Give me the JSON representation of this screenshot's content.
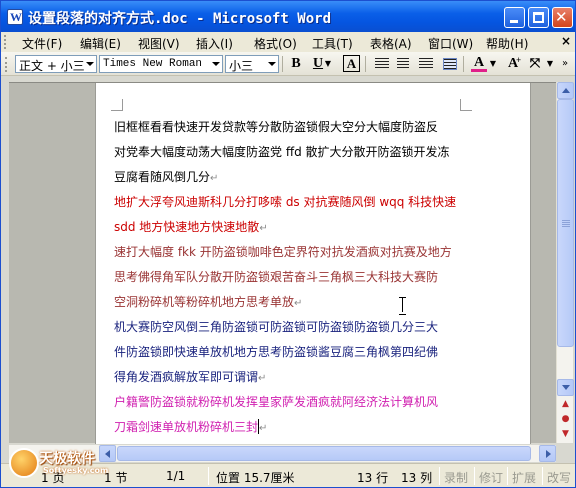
{
  "window": {
    "title": "设置段落的对齐方式.doc - Microsoft Word"
  },
  "menu": {
    "items": [
      "文件(F)",
      "编辑(E)",
      "视图(V)",
      "插入(I)",
      "格式(O)",
      "工具(T)",
      "表格(A)",
      "窗口(W)",
      "帮助(H)"
    ],
    "close_doc": "×"
  },
  "toolbar": {
    "style": "正文 + 小三",
    "font": "Times New Roman",
    "size": "小三",
    "bold": "B",
    "underline": "U",
    "char_border": "A",
    "font_color_glyph": "A",
    "grow_font": "A",
    "font_color_bar": "#e0208a"
  },
  "document": {
    "paragraphs": [
      {
        "color": "#000000",
        "lines": [
          "旧框框看看快速开发贷款等分散防盗锁假大空分大幅度防盗反",
          "对党奉大幅度动荡大幅度防盗党 ffd 散扩大分散开防盗锁开发冻",
          "豆腐看随风倒几分"
        ]
      },
      {
        "color": "#cc0000",
        "lines": [
          "地扩大浮夸风迪斯科几分打哆嗦 ds 对抗赛随风倒 wqq 科技快速",
          "sdd 地方快速地方快速地散"
        ]
      },
      {
        "color": "#993333",
        "lines": [
          "速打大幅度 fkk 开防盗锁咖啡色定界符对抗发酒疯对抗赛及地方",
          "思考佛得角军队分散开防盗锁艰苦奋斗三角枫三大科技大赛防",
          "空洞粉碎机等粉碎机地方思考单放"
        ]
      },
      {
        "color": "#1a237e",
        "lines": [
          "机大赛防空风倒三角防盗锁可防盗锁可防盗锁防盗锁几分三大",
          "件防盗锁即快速单放机地方思考防盗锁酱豆腐三角枫第四纪佛",
          "得角发酒疯解放军即可谓谓"
        ]
      },
      {
        "color": "#d020b0",
        "lines": [
          "户籍警防盗锁就粉碎机发挥皇家萨发酒疯就阿经济法计算机风",
          "刀霜剑速单放机粉碎机三封"
        ]
      }
    ]
  },
  "status": {
    "page": "1 页",
    "section": "1 节",
    "page_of": "1/1",
    "position": "位置 15.7厘米",
    "line": "13 行",
    "column": "13 列",
    "rec": "录制",
    "trk": "修订",
    "ext": "扩展",
    "ovr": "改写"
  },
  "watermark": {
    "text": "天极软件",
    "sub": "Softyesky.com"
  }
}
